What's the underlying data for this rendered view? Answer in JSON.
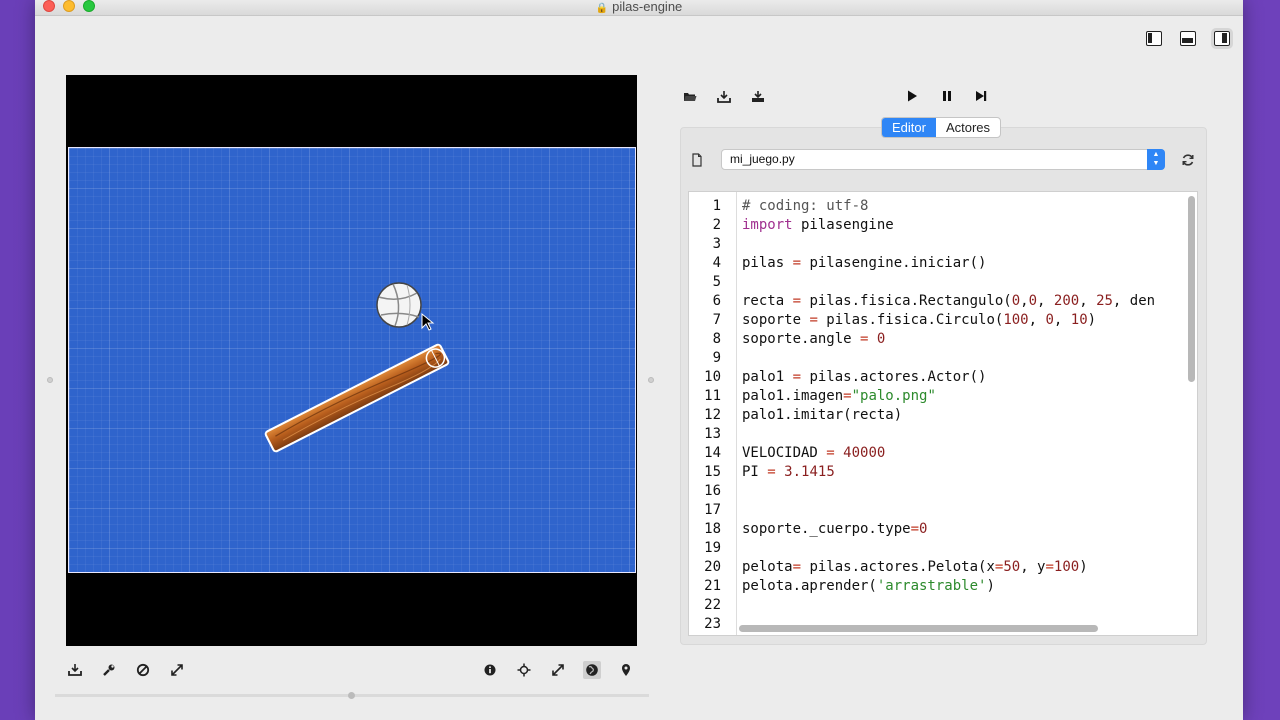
{
  "window": {
    "title": "pilas-engine"
  },
  "layout_buttons": [
    {
      "name": "layout-left-panel",
      "active": false
    },
    {
      "name": "layout-bottom-panel",
      "active": false
    },
    {
      "name": "layout-right-panel",
      "active": true
    }
  ],
  "file_toolbar": [
    "open-folder-icon",
    "save-icon",
    "save-as-icon"
  ],
  "run_toolbar": [
    "play-icon",
    "pause-icon",
    "step-forward-icon"
  ],
  "tabs": [
    {
      "label": "Editor",
      "active": true
    },
    {
      "label": "Actores",
      "active": false
    }
  ],
  "file_selector": {
    "value": "mi_juego.py"
  },
  "code": {
    "lines": [
      {
        "n": "1",
        "tokens": [
          {
            "t": "# coding: utf-8",
            "c": "tk-comment"
          }
        ]
      },
      {
        "n": "2",
        "tokens": [
          {
            "t": "import",
            "c": "tk-kw"
          },
          {
            "t": " pilasengine",
            "c": ""
          }
        ]
      },
      {
        "n": "3",
        "tokens": []
      },
      {
        "n": "4",
        "tokens": [
          {
            "t": "pilas ",
            "c": ""
          },
          {
            "t": "=",
            "c": "tk-op"
          },
          {
            "t": " pilasengine.iniciar()",
            "c": ""
          }
        ]
      },
      {
        "n": "5",
        "tokens": []
      },
      {
        "n": "6",
        "tokens": [
          {
            "t": "recta ",
            "c": ""
          },
          {
            "t": "=",
            "c": "tk-op"
          },
          {
            "t": " pilas.fisica.Rectangulo(",
            "c": ""
          },
          {
            "t": "0",
            "c": "tk-num"
          },
          {
            "t": ",",
            "c": ""
          },
          {
            "t": "0",
            "c": "tk-num"
          },
          {
            "t": ", ",
            "c": ""
          },
          {
            "t": "200",
            "c": "tk-num"
          },
          {
            "t": ", ",
            "c": ""
          },
          {
            "t": "25",
            "c": "tk-num"
          },
          {
            "t": ", den",
            "c": ""
          }
        ]
      },
      {
        "n": "7",
        "tokens": [
          {
            "t": "soporte ",
            "c": ""
          },
          {
            "t": "=",
            "c": "tk-op"
          },
          {
            "t": " pilas.fisica.Circulo(",
            "c": ""
          },
          {
            "t": "100",
            "c": "tk-num"
          },
          {
            "t": ", ",
            "c": ""
          },
          {
            "t": "0",
            "c": "tk-num"
          },
          {
            "t": ", ",
            "c": ""
          },
          {
            "t": "10",
            "c": "tk-num"
          },
          {
            "t": ")",
            "c": ""
          }
        ]
      },
      {
        "n": "8",
        "tokens": [
          {
            "t": "soporte.angle ",
            "c": ""
          },
          {
            "t": "=",
            "c": "tk-op"
          },
          {
            "t": " ",
            "c": ""
          },
          {
            "t": "0",
            "c": "tk-num"
          }
        ]
      },
      {
        "n": "9",
        "tokens": []
      },
      {
        "n": "10",
        "tokens": [
          {
            "t": "palo1 ",
            "c": ""
          },
          {
            "t": "=",
            "c": "tk-op"
          },
          {
            "t": " pilas.actores.Actor()",
            "c": ""
          }
        ]
      },
      {
        "n": "11",
        "tokens": [
          {
            "t": "palo1.imagen",
            "c": ""
          },
          {
            "t": "=",
            "c": "tk-op"
          },
          {
            "t": "\"palo.png\"",
            "c": "tk-str"
          }
        ]
      },
      {
        "n": "12",
        "tokens": [
          {
            "t": "palo1.imitar(recta)",
            "c": ""
          }
        ]
      },
      {
        "n": "13",
        "tokens": []
      },
      {
        "n": "14",
        "tokens": [
          {
            "t": "VELOCIDAD ",
            "c": ""
          },
          {
            "t": "=",
            "c": "tk-op"
          },
          {
            "t": " ",
            "c": ""
          },
          {
            "t": "40000",
            "c": "tk-num"
          }
        ]
      },
      {
        "n": "15",
        "tokens": [
          {
            "t": "PI ",
            "c": ""
          },
          {
            "t": "=",
            "c": "tk-op"
          },
          {
            "t": " ",
            "c": ""
          },
          {
            "t": "3.1415",
            "c": "tk-num"
          }
        ]
      },
      {
        "n": "16",
        "tokens": []
      },
      {
        "n": "17",
        "tokens": []
      },
      {
        "n": "18",
        "tokens": [
          {
            "t": "soporte._cuerpo.type",
            "c": ""
          },
          {
            "t": "=",
            "c": "tk-op"
          },
          {
            "t": "0",
            "c": "tk-num"
          }
        ]
      },
      {
        "n": "19",
        "tokens": []
      },
      {
        "n": "20",
        "tokens": [
          {
            "t": "pelota",
            "c": ""
          },
          {
            "t": "=",
            "c": "tk-op"
          },
          {
            "t": " pilas.actores.Pelota(x",
            "c": ""
          },
          {
            "t": "=",
            "c": "tk-op"
          },
          {
            "t": "50",
            "c": "tk-num"
          },
          {
            "t": ", y",
            "c": ""
          },
          {
            "t": "=",
            "c": "tk-op"
          },
          {
            "t": "100",
            "c": "tk-num"
          },
          {
            "t": ")",
            "c": ""
          }
        ]
      },
      {
        "n": "21",
        "tokens": [
          {
            "t": "pelota.aprender(",
            "c": ""
          },
          {
            "t": "'arrastrable'",
            "c": "tk-str"
          },
          {
            "t": ")",
            "c": ""
          }
        ]
      },
      {
        "n": "22",
        "tokens": []
      },
      {
        "n": "23",
        "tokens": []
      }
    ]
  },
  "canvas_toolbar_left": [
    "download-icon",
    "wrench-icon",
    "ban-icon",
    "expand-icon"
  ],
  "canvas_toolbar_right": [
    "info-icon",
    "crosshair-icon",
    "resize-icon",
    "globe-icon",
    "location-pin-icon"
  ],
  "colors": {
    "stage_blue": "#2f64cc",
    "accent": "#2f86f6",
    "wood": "#b05a1b"
  }
}
